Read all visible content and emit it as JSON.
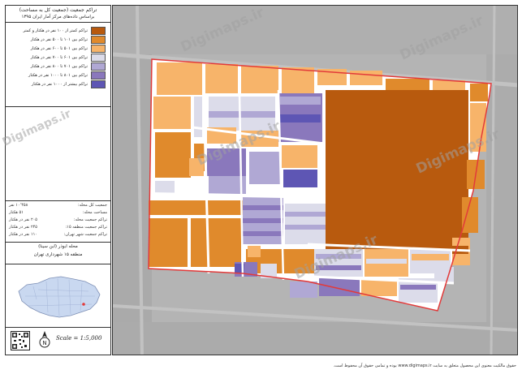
{
  "title": {
    "line1": "تراکم جمعیت (جمعیت کل به مساحت)",
    "line2": "براساس داده‌های مرکز آمار ایران ۱۳۹۵"
  },
  "legend": [
    {
      "label": "تراکم کمتر از ۱۰۰ نفر در هکتار و کمتر",
      "color": "#b85a0e"
    },
    {
      "label": "تراکم بین ۱۰۱ تا ۵۰۰ نفر در هکتار",
      "color": "#e08a2c"
    },
    {
      "label": "تراکم بین ۵۰۱ تا ۶۰۰ نفر در هکتار",
      "color": "#f7b46a"
    },
    {
      "label": "تراکم بین ۶۰۱ تا ۷۰۰ نفر در هکتار",
      "color": "#dcdcea"
    },
    {
      "label": "تراکم بین ۷۰۱ تا ۸۰۰ نفر در هکتار",
      "color": "#b0a8d4"
    },
    {
      "label": "تراکم بین ۸۰۱ تا ۱۰۰۰ نفر در هکتار",
      "color": "#8a78bc"
    },
    {
      "label": "تراکم بیشتر از ۱۰۰۰ نفر در هکتار",
      "color": "#5e56b4"
    }
  ],
  "stats": [
    {
      "label": "جمعیت کل محله:",
      "value": "۱۰٬۴۵۸ نفر"
    },
    {
      "label": "مساحت محله:",
      "value": "۵۱ هکتار"
    },
    {
      "label": "تراکم جمعیت محله:",
      "value": "۲۰۵ نفر در هکتار"
    },
    {
      "label": "تراکم جمعیت منطقه ۱۵:",
      "value": "۲۴۵ نفر در هکتار"
    },
    {
      "label": "تراکم جمعیت شهر تهران:",
      "value": "۱۱۰ نفر در هکتار"
    }
  ],
  "district": {
    "line1": "محله ابوذر (ابن سینا)",
    "line2": "منطقه ۱۵ شهرداری تهران"
  },
  "scale_text": "Scale = 1:5,000",
  "north_label": "N",
  "watermark": "Digimaps.ir",
  "footer_text": "حقوق مالکیت معنوی این محصول متعلق به سایت www.digimaps.ir بوده و تمامی حقوق آن محفوظ است.",
  "colors": {
    "c1": "#b85a0e",
    "c2": "#e08a2c",
    "c3": "#f7b46a",
    "c4": "#dcdcea",
    "c5": "#b0a8d4",
    "c6": "#8a78bc",
    "c7": "#5e56b4",
    "boundary": "#e23a3a",
    "basemap": "#b8b8b8"
  }
}
